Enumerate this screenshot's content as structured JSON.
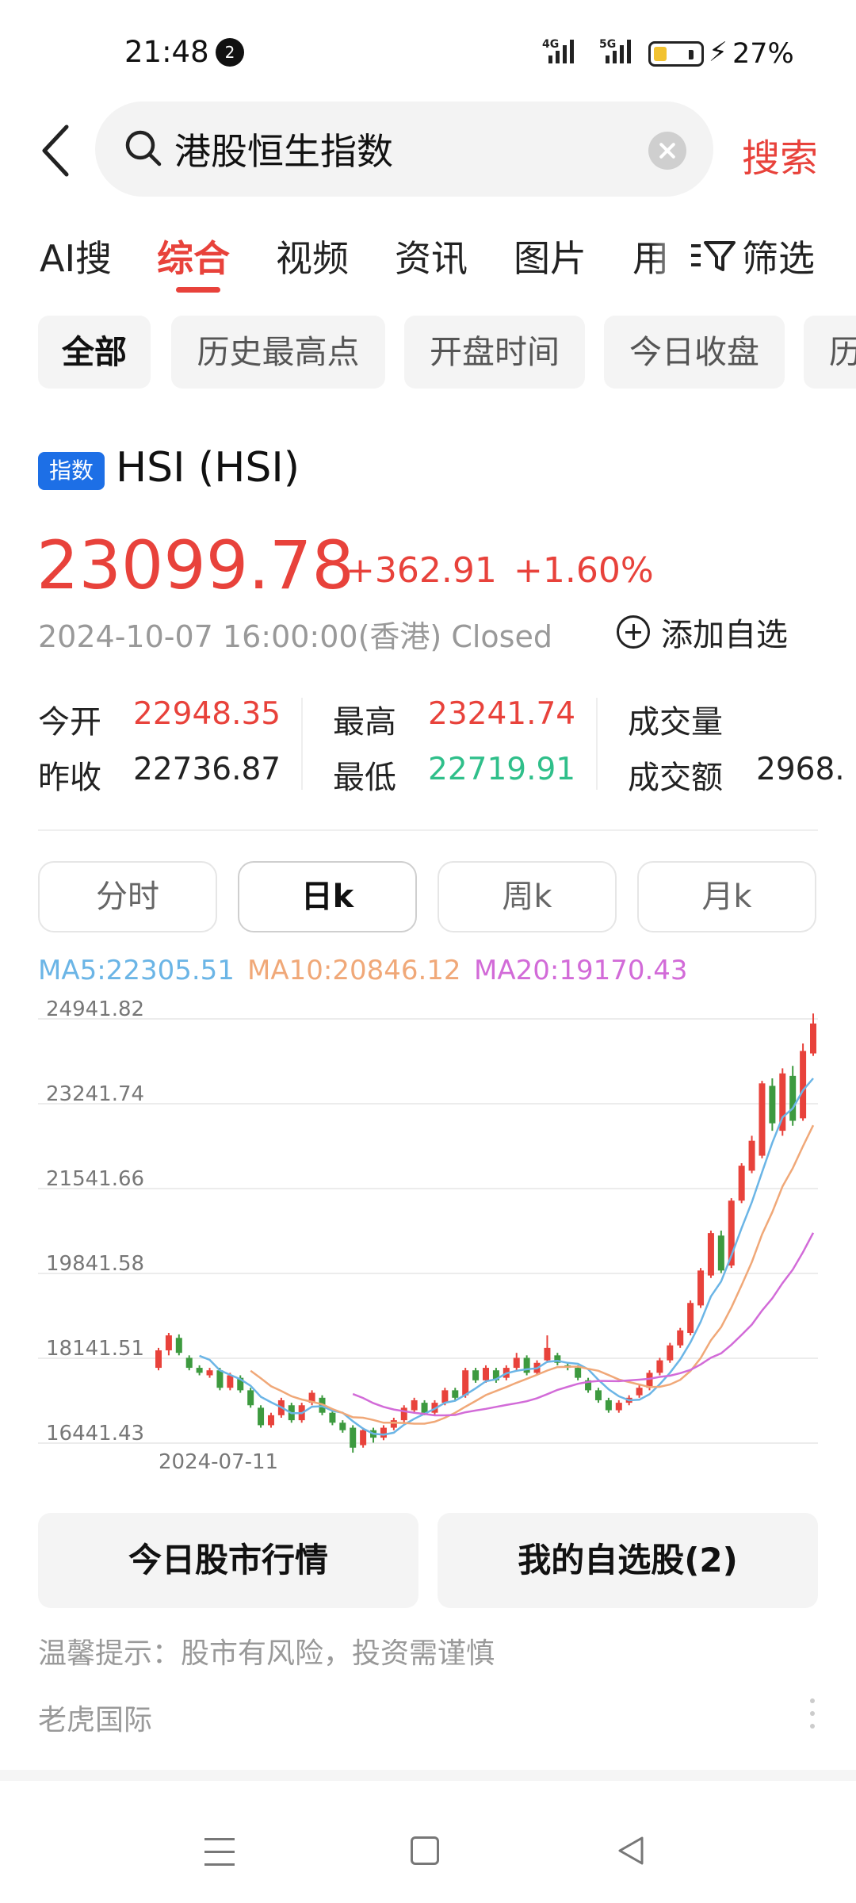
{
  "status_bar": {
    "time": "21:48",
    "notification_count": "2",
    "network_1": "4G",
    "network_2": "5G",
    "battery_percent": "27%",
    "battery_level": 0.27
  },
  "search": {
    "query": "港股恒生指数",
    "search_button": "搜索"
  },
  "tabs": [
    {
      "label": "AI搜"
    },
    {
      "label": "综合"
    },
    {
      "label": "视频"
    },
    {
      "label": "资讯"
    },
    {
      "label": "图片"
    },
    {
      "label": "用"
    }
  ],
  "active_tab": "综合",
  "filter_label": "筛选",
  "chips": [
    {
      "label": "全部"
    },
    {
      "label": "历史最高点"
    },
    {
      "label": "开盘时间"
    },
    {
      "label": "今日收盘"
    },
    {
      "label": "历"
    }
  ],
  "index": {
    "tag": "指数",
    "name": "HSI (HSI)",
    "price": "23099.78",
    "change": "+362.91",
    "change_pct": "+1.60%",
    "datetime": "2024-10-07 16:00:00(香港) Closed",
    "add_watch": "添加自选"
  },
  "stats": {
    "open_label": "今开",
    "open": "22948.35",
    "prev_close_label": "昨收",
    "prev_close": "22736.87",
    "high_label": "最高",
    "high": "23241.74",
    "low_label": "最低",
    "low": "22719.91",
    "volume_label": "成交量",
    "volume": "",
    "turnover_label": "成交额",
    "turnover": "2968."
  },
  "periods": [
    {
      "label": "分时"
    },
    {
      "label": "日k"
    },
    {
      "label": "周k"
    },
    {
      "label": "月k"
    }
  ],
  "active_period": "日k",
  "ma_legend": {
    "ma5": "MA5:22305.51",
    "ma10": "MA10:20846.12",
    "ma20": "MA20:19170.43"
  },
  "colors": {
    "up": "#e8423b",
    "down": "#3d9a3f",
    "ma5": "#6bb5e6",
    "ma10": "#f0a878",
    "ma20": "#d26bd8",
    "accent": "#e8423b",
    "tag": "#1d6fe6"
  },
  "chart_data": {
    "type": "candlestick",
    "y_ticks": [
      "24941.82",
      "23241.74",
      "21541.66",
      "19841.58",
      "18141.51",
      "16441.43"
    ],
    "ylim": [
      16441.43,
      24941.82
    ],
    "x_label": "2024-07-11",
    "candles": [
      [
        17950,
        18300,
        18350,
        17900
      ],
      [
        18300,
        18600,
        18650,
        18200
      ],
      [
        18550,
        18250,
        18620,
        18200
      ],
      [
        18150,
        17950,
        18200,
        17900
      ],
      [
        17950,
        17850,
        18000,
        17800
      ],
      [
        17800,
        17900,
        17950,
        17750
      ],
      [
        17900,
        17550,
        17950,
        17500
      ],
      [
        17550,
        17800,
        17850,
        17500
      ],
      [
        17750,
        17500,
        17800,
        17450
      ],
      [
        17500,
        17200,
        17550,
        17150
      ],
      [
        17150,
        16800,
        17200,
        16750
      ],
      [
        16800,
        17000,
        17050,
        16750
      ],
      [
        17000,
        17300,
        17350,
        16950
      ],
      [
        17200,
        16900,
        17250,
        16850
      ],
      [
        16900,
        17200,
        17250,
        16850
      ],
      [
        17250,
        17450,
        17500,
        17200
      ],
      [
        17350,
        17050,
        17400,
        17000
      ],
      [
        17050,
        16850,
        17100,
        16800
      ],
      [
        16850,
        16700,
        16900,
        16650
      ],
      [
        16750,
        16350,
        16800,
        16250
      ],
      [
        16400,
        16700,
        16750,
        16350
      ],
      [
        16700,
        16550,
        16750,
        16450
      ],
      [
        16550,
        16750,
        16800,
        16500
      ],
      [
        16750,
        16900,
        16950,
        16700
      ],
      [
        16900,
        17150,
        17200,
        16850
      ],
      [
        17100,
        17300,
        17350,
        17050
      ],
      [
        17250,
        17050,
        17300,
        17000
      ],
      [
        17050,
        17250,
        17300,
        17000
      ],
      [
        17250,
        17500,
        17550,
        17200
      ],
      [
        17500,
        17350,
        17550,
        17300
      ],
      [
        17400,
        17900,
        17950,
        17350
      ],
      [
        17900,
        17700,
        17950,
        17650
      ],
      [
        17700,
        17950,
        18000,
        17650
      ],
      [
        17900,
        17700,
        17950,
        17650
      ],
      [
        17750,
        17950,
        18000,
        17700
      ],
      [
        17950,
        18150,
        18250,
        17900
      ],
      [
        18150,
        17850,
        18200,
        17800
      ],
      [
        17850,
        18050,
        18100,
        17800
      ],
      [
        18100,
        18350,
        18600,
        18050
      ],
      [
        18200,
        18050,
        18250,
        18000
      ],
      [
        18000,
        17950,
        18050,
        17900
      ],
      [
        17950,
        17750,
        18000,
        17700
      ],
      [
        17700,
        17500,
        17750,
        17450
      ],
      [
        17500,
        17300,
        17550,
        17250
      ],
      [
        17300,
        17100,
        17350,
        17050
      ],
      [
        17100,
        17250,
        17300,
        17050
      ],
      [
        17250,
        17350,
        17400,
        17200
      ],
      [
        17400,
        17550,
        17600,
        17350
      ],
      [
        17550,
        17850,
        17900,
        17500
      ],
      [
        17850,
        18100,
        18150,
        17800
      ],
      [
        18100,
        18400,
        18450,
        18050
      ],
      [
        18400,
        18700,
        18750,
        18350
      ],
      [
        18650,
        19250,
        19300,
        18600
      ],
      [
        19200,
        19900,
        19950,
        19150
      ],
      [
        19800,
        20650,
        20700,
        19750
      ],
      [
        20600,
        19900,
        20700,
        19850
      ],
      [
        20000,
        21300,
        21350,
        19950
      ],
      [
        21300,
        22000,
        22050,
        21250
      ],
      [
        21900,
        22500,
        22600,
        21850
      ],
      [
        22200,
        23650,
        23700,
        22150
      ],
      [
        23600,
        22850,
        23750,
        22700
      ],
      [
        22700,
        23850,
        23950,
        22600
      ],
      [
        23800,
        22900,
        24000,
        22800
      ],
      [
        22950,
        24300,
        24450,
        22900
      ],
      [
        24250,
        24850,
        25050,
        24200
      ]
    ]
  }
}
